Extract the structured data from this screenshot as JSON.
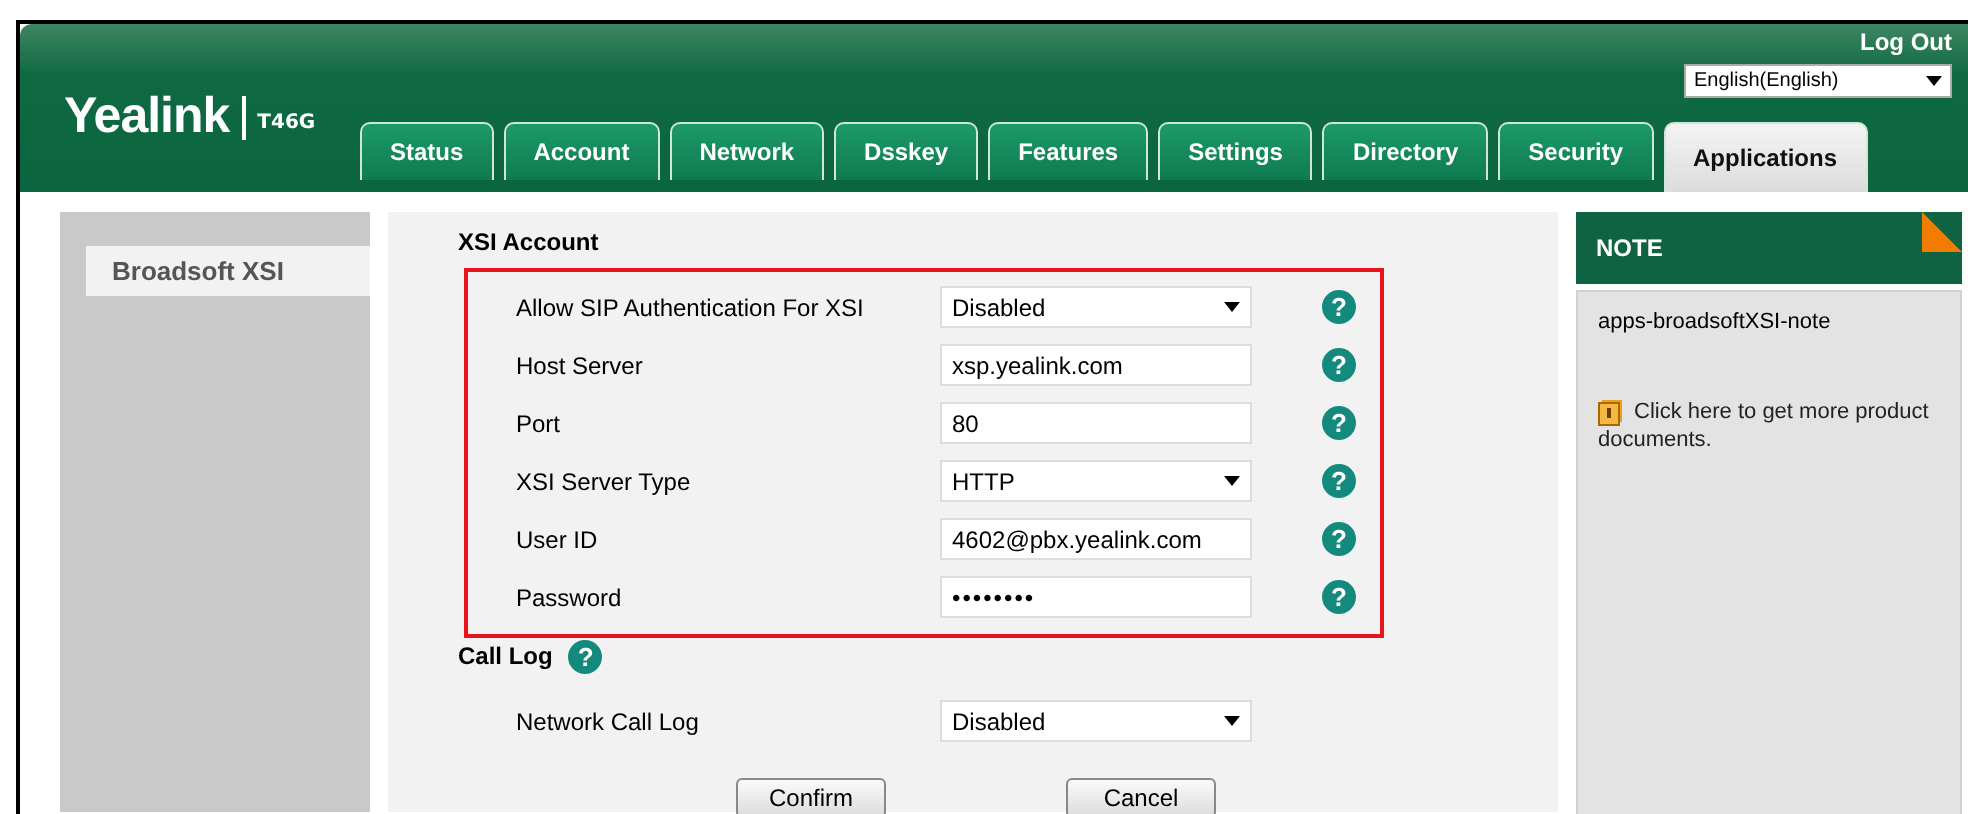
{
  "header": {
    "logo": "Yealink",
    "model": "T46G",
    "logout": "Log Out",
    "language": "English(English)"
  },
  "tabs": [
    {
      "label": "Status",
      "selected": false
    },
    {
      "label": "Account",
      "selected": false
    },
    {
      "label": "Network",
      "selected": false
    },
    {
      "label": "Dsskey",
      "selected": false
    },
    {
      "label": "Features",
      "selected": false
    },
    {
      "label": "Settings",
      "selected": false
    },
    {
      "label": "Directory",
      "selected": false
    },
    {
      "label": "Security",
      "selected": false
    },
    {
      "label": "Applications",
      "selected": true
    }
  ],
  "sidebar": {
    "items": [
      {
        "label": "Broadsoft XSI",
        "selected": true
      }
    ]
  },
  "sections": [
    {
      "title": "XSI Account",
      "highlighted": true,
      "fields": [
        {
          "label": "Allow SIP Authentication For XSI",
          "kind": "select",
          "value": "Disabled",
          "help": "?"
        },
        {
          "label": "Host Server",
          "kind": "text",
          "value": "xsp.yealink.com",
          "help": "?"
        },
        {
          "label": "Port",
          "kind": "text",
          "value": "80",
          "help": "?"
        },
        {
          "label": "XSI Server Type",
          "kind": "select",
          "value": "HTTP",
          "help": "?"
        },
        {
          "label": "User ID",
          "kind": "text",
          "value": "4602@pbx.yealink.com",
          "help": "?"
        },
        {
          "label": "Password",
          "kind": "password",
          "value": "••••••••",
          "help": "?"
        }
      ]
    },
    {
      "title": "Call Log",
      "help": "?",
      "highlighted": false,
      "fields": [
        {
          "label": "Network Call Log",
          "kind": "select",
          "value": "Disabled"
        }
      ]
    }
  ],
  "buttons": [
    "Confirm",
    "Cancel"
  ],
  "note": {
    "title": "NOTE",
    "text": "apps-broadsoftXSI-note",
    "link": "Click here to get more product documents."
  }
}
